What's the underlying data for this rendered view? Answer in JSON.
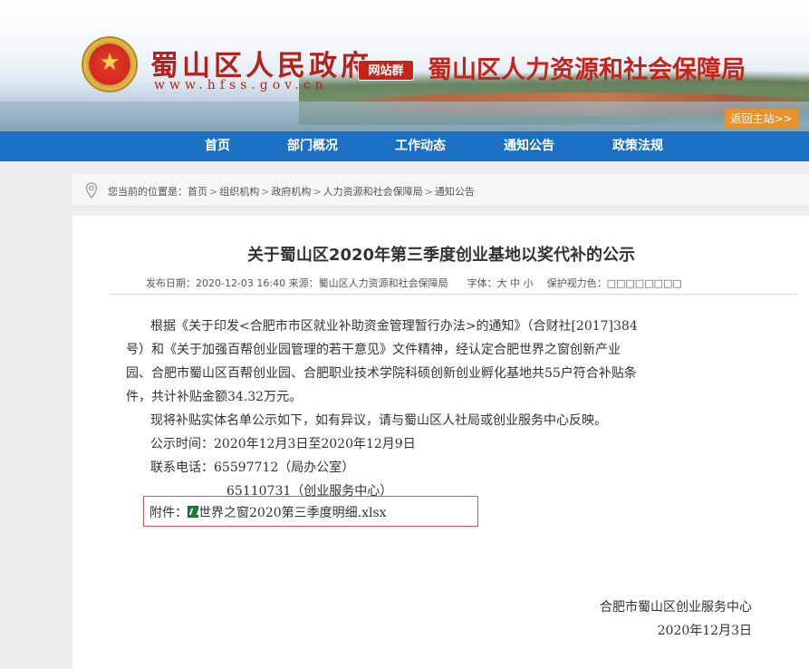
{
  "header": {
    "gov_title": "蜀山区人民政府",
    "gov_url": "www.hfss.gov.cn",
    "badge": "网站群",
    "bureau_title": "蜀山区人力资源和社会保障局",
    "back_button": "返回主站>>",
    "colors": {
      "brand_red": "#c4241b",
      "accent_orange": "#e8922e"
    }
  },
  "nav": {
    "items": [
      {
        "label": "首页"
      },
      {
        "label": "部门概况"
      },
      {
        "label": "工作动态"
      },
      {
        "label": "通知公告"
      },
      {
        "label": "政策法规"
      }
    ],
    "color": "#1c70c4"
  },
  "breadcrumb": {
    "prefix": "您当前的位置是：",
    "items": [
      "首页",
      "组织机构",
      "政府机构",
      "人力资源和社会保障局",
      "通知公告"
    ],
    "separator": ">"
  },
  "article": {
    "title": "关于蜀山区2020年第三季度创业基地以奖代补的公示",
    "meta": {
      "date_label": "发布日期：",
      "date": "2020-12-03 16:40",
      "source_label": "来源：",
      "source": "蜀山区人力资源和社会保障局",
      "font_label": "字体：",
      "font_large": "大",
      "font_medium": "中",
      "font_small": "小",
      "eye_label": "保护视力色：",
      "eye_swatches": "□□□□□□□□"
    },
    "paragraphs": [
      "根据《关于印发<合肥市市区就业补助资金管理暂行办法>的通知》（合财社[2017]384",
      "号）和《关于加强百帮创业园管理的若干意见》文件精神，经认定合肥世界之窗创新产业",
      "园、合肥市蜀山区百帮创业园、合肥职业技术学院科硕创新创业孵化基地共55户符合补贴条",
      "件，共计补贴金额34.32万元。",
      "现将补贴实体名单公示如下，如有异议，请与蜀山区人社局或创业服务中心反映。",
      "公示时间：2020年12月3日至2020年12月9日",
      "联系电话：65597712（局办公室）",
      "65110731（创业服务中心）"
    ],
    "attachment_label": "附件：",
    "attachment_file": "世界之窗2020第三季度明细.xlsx",
    "signature": "合肥市蜀山区创业服务中心",
    "sign_date": "2020年12月3日"
  }
}
